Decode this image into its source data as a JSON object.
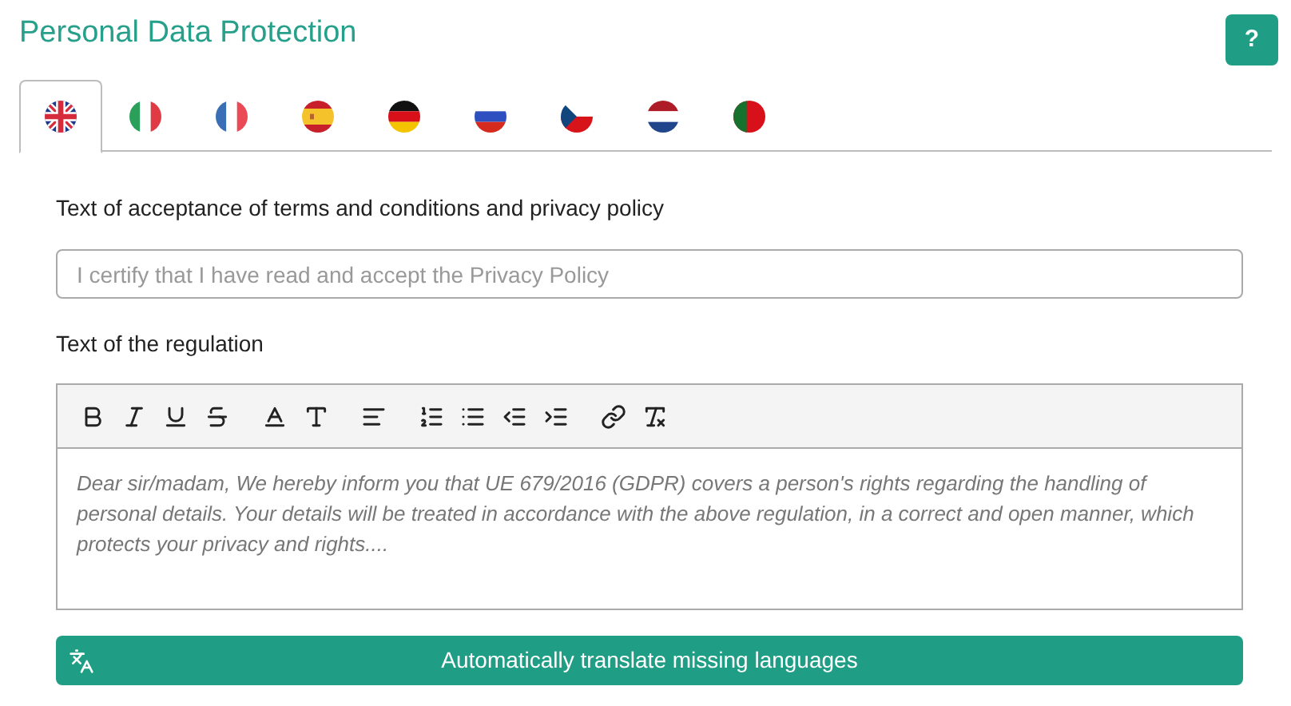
{
  "title": "Personal Data Protection",
  "help_button": "?",
  "tabs": [
    {
      "selected": true
    },
    {
      "selected": false
    },
    {
      "selected": false
    },
    {
      "selected": false
    },
    {
      "selected": false
    },
    {
      "selected": false
    },
    {
      "selected": false
    },
    {
      "selected": false
    },
    {
      "selected": false
    }
  ],
  "acceptance": {
    "label": "Text of acceptance of terms and conditions and privacy policy",
    "placeholder": "I certify that I have read and accept the Privacy Policy"
  },
  "regulation": {
    "label": "Text of the regulation",
    "placeholder": "Dear sir/madam, We hereby inform you that UE 679/2016 (GDPR) covers a person's rights regarding the handling of personal details. Your details will be treated in accordance with the above regulation, in a correct and open manner, which protects your privacy and rights...."
  },
  "translate_button": "Automatically translate missing languages"
}
